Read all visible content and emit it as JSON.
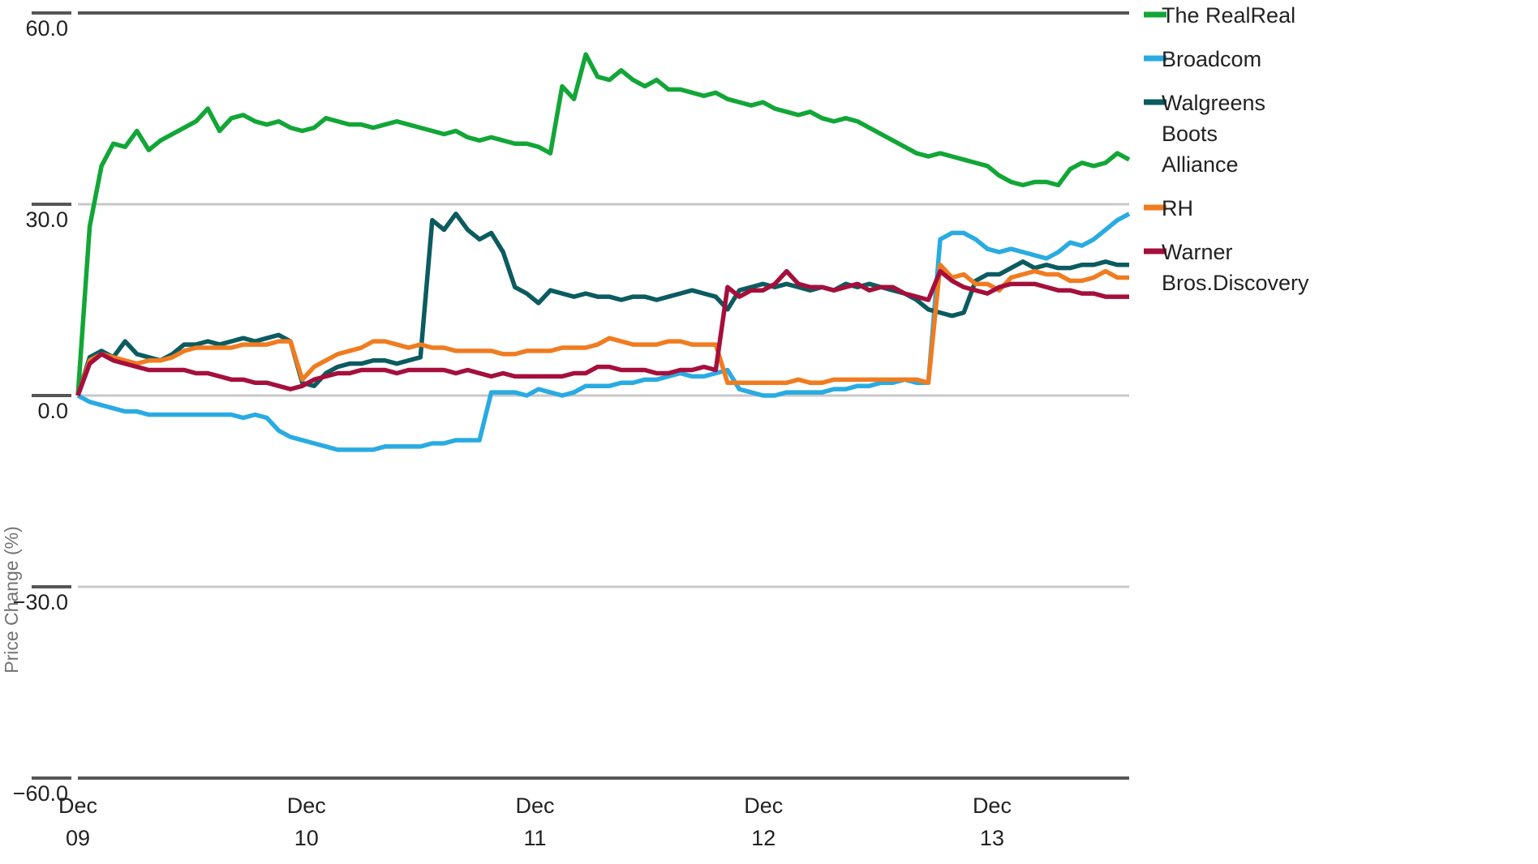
{
  "chart_data": {
    "type": "line",
    "title": "",
    "xlabel": "",
    "ylabel": "Price Change (%)",
    "ylim": [
      -60.0,
      60.0
    ],
    "yticks": [
      60.0,
      30.0,
      0.0,
      -30.0,
      -60.0
    ],
    "ytick_labels": [
      "60.0",
      "30.0",
      "0.0",
      "−30.0",
      "−60.0"
    ],
    "xtick_labels": [
      {
        "month": "Dec",
        "day": "09"
      },
      {
        "month": "Dec",
        "day": "10"
      },
      {
        "month": "Dec",
        "day": "11"
      },
      {
        "month": "Dec",
        "day": "12"
      },
      {
        "month": "Dec",
        "day": "13"
      }
    ],
    "grid": true,
    "legend_position": "right",
    "x_range_days": [
      0,
      4.6
    ],
    "series": [
      {
        "name": "The RealReal",
        "color": "#12A637",
        "values": [
          0.0,
          26.5,
          36.0,
          39.5,
          39.0,
          41.5,
          38.5,
          40.0,
          41.0,
          42.0,
          43.0,
          45.0,
          41.5,
          43.5,
          44.0,
          43.0,
          42.5,
          43.0,
          42.0,
          41.5,
          42.0,
          43.5,
          43.0,
          42.5,
          42.5,
          42.0,
          42.5,
          43.0,
          42.5,
          42.0,
          41.5,
          41.0,
          41.5,
          40.5,
          40.0,
          40.5,
          40.0,
          39.5,
          39.5,
          39.0,
          38.0,
          48.5,
          46.5,
          53.5,
          50.0,
          49.5,
          51.0,
          49.5,
          48.5,
          49.5,
          48.0,
          48.0,
          47.5,
          47.0,
          47.5,
          46.5,
          46.0,
          45.5,
          46.0,
          45.0,
          44.5,
          44.0,
          44.5,
          43.5,
          43.0,
          43.5,
          43.0,
          42.0,
          41.0,
          40.0,
          39.0,
          38.0,
          37.5,
          38.0,
          37.5,
          37.0,
          36.5,
          36.0,
          34.5,
          33.5,
          33.0,
          33.5,
          33.5,
          33.0,
          35.5,
          36.5,
          36.0,
          36.5,
          38.0,
          37.0
        ]
      },
      {
        "name": "Broadcom",
        "color": "#29ABE2",
        "values": [
          0.0,
          -1.0,
          -1.5,
          -2.0,
          -2.5,
          -2.5,
          -3.0,
          -3.0,
          -3.0,
          -3.0,
          -3.0,
          -3.0,
          -3.0,
          -3.0,
          -3.5,
          -3.0,
          -3.5,
          -5.5,
          -6.5,
          -7.0,
          -7.5,
          -8.0,
          -8.5,
          -8.5,
          -8.5,
          -8.5,
          -8.0,
          -8.0,
          -8.0,
          -8.0,
          -7.5,
          -7.5,
          -7.0,
          -7.0,
          -7.0,
          0.5,
          0.5,
          0.5,
          0.0,
          1.0,
          0.5,
          0.0,
          0.5,
          1.5,
          1.5,
          1.5,
          2.0,
          2.0,
          2.5,
          2.5,
          3.0,
          3.5,
          3.0,
          3.0,
          3.5,
          4.0,
          1.0,
          0.5,
          0.0,
          0.0,
          0.5,
          0.5,
          0.5,
          0.5,
          1.0,
          1.0,
          1.5,
          1.5,
          2.0,
          2.0,
          2.5,
          2.0,
          2.0,
          24.5,
          25.5,
          25.5,
          24.5,
          23.0,
          22.5,
          23.0,
          22.5,
          22.0,
          21.5,
          22.5,
          24.0,
          23.5,
          24.5,
          26.0,
          27.5,
          28.5
        ]
      },
      {
        "name": "Walgreens Boots Alliance",
        "color": "#0B5B60",
        "values": [
          0.0,
          6.0,
          7.0,
          6.0,
          8.5,
          6.5,
          6.0,
          5.5,
          6.5,
          8.0,
          8.0,
          8.5,
          8.0,
          8.5,
          9.0,
          8.5,
          9.0,
          9.5,
          8.5,
          2.0,
          1.5,
          3.5,
          4.5,
          5.0,
          5.0,
          5.5,
          5.5,
          5.0,
          5.5,
          6.0,
          27.5,
          26.0,
          28.5,
          26.0,
          24.5,
          25.5,
          22.5,
          17.0,
          16.0,
          14.5,
          16.5,
          16.0,
          15.5,
          16.0,
          15.5,
          15.5,
          15.0,
          15.5,
          15.5,
          15.0,
          15.5,
          16.0,
          16.5,
          16.0,
          15.5,
          13.5,
          16.5,
          17.0,
          17.5,
          17.0,
          17.5,
          17.0,
          16.5,
          17.0,
          16.5,
          17.5,
          17.0,
          17.5,
          17.0,
          16.5,
          16.0,
          15.0,
          13.5,
          13.0,
          12.5,
          13.0,
          18.0,
          19.0,
          19.0,
          20.0,
          21.0,
          20.0,
          20.5,
          20.0,
          20.0,
          20.5,
          20.5,
          21.0,
          20.5,
          20.5
        ]
      },
      {
        "name": "RH",
        "color": "#F07C20",
        "values": [
          0.0,
          5.5,
          6.5,
          6.0,
          5.5,
          5.0,
          5.5,
          5.5,
          6.0,
          7.0,
          7.5,
          7.5,
          7.5,
          7.5,
          8.0,
          8.0,
          8.0,
          8.5,
          8.5,
          2.5,
          4.5,
          5.5,
          6.5,
          7.0,
          7.5,
          8.5,
          8.5,
          8.0,
          7.5,
          8.0,
          7.5,
          7.5,
          7.0,
          7.0,
          7.0,
          7.0,
          6.5,
          6.5,
          7.0,
          7.0,
          7.0,
          7.5,
          7.5,
          7.5,
          8.0,
          9.0,
          8.5,
          8.0,
          8.0,
          8.0,
          8.5,
          8.5,
          8.0,
          8.0,
          8.0,
          2.0,
          2.0,
          2.0,
          2.0,
          2.0,
          2.0,
          2.5,
          2.0,
          2.0,
          2.5,
          2.5,
          2.5,
          2.5,
          2.5,
          2.5,
          2.5,
          2.5,
          2.0,
          20.5,
          18.5,
          19.0,
          17.5,
          17.5,
          16.5,
          18.5,
          19.0,
          19.5,
          19.0,
          19.0,
          18.0,
          18.0,
          18.5,
          19.5,
          18.5,
          18.5
        ]
      },
      {
        "name": "Warner Bros.Discovery",
        "color": "#A50F3C",
        "values": [
          0.0,
          5.0,
          6.5,
          5.5,
          5.0,
          4.5,
          4.0,
          4.0,
          4.0,
          4.0,
          3.5,
          3.5,
          3.0,
          2.5,
          2.5,
          2.0,
          2.0,
          1.5,
          1.0,
          1.5,
          2.5,
          3.0,
          3.5,
          3.5,
          4.0,
          4.0,
          4.0,
          3.5,
          4.0,
          4.0,
          4.0,
          4.0,
          3.5,
          4.0,
          3.5,
          3.0,
          3.5,
          3.0,
          3.0,
          3.0,
          3.0,
          3.0,
          3.5,
          3.5,
          4.5,
          4.5,
          4.0,
          4.0,
          4.0,
          3.5,
          3.5,
          4.0,
          4.0,
          4.5,
          4.0,
          17.0,
          15.5,
          16.5,
          16.5,
          17.5,
          19.5,
          17.5,
          17.0,
          17.0,
          16.5,
          17.0,
          17.5,
          16.5,
          17.0,
          17.0,
          16.0,
          15.5,
          15.0,
          19.5,
          18.0,
          17.0,
          16.5,
          16.0,
          17.0,
          17.5,
          17.5,
          17.5,
          17.0,
          16.5,
          16.5,
          16.0,
          16.0,
          15.5,
          15.5,
          15.5
        ]
      }
    ]
  }
}
